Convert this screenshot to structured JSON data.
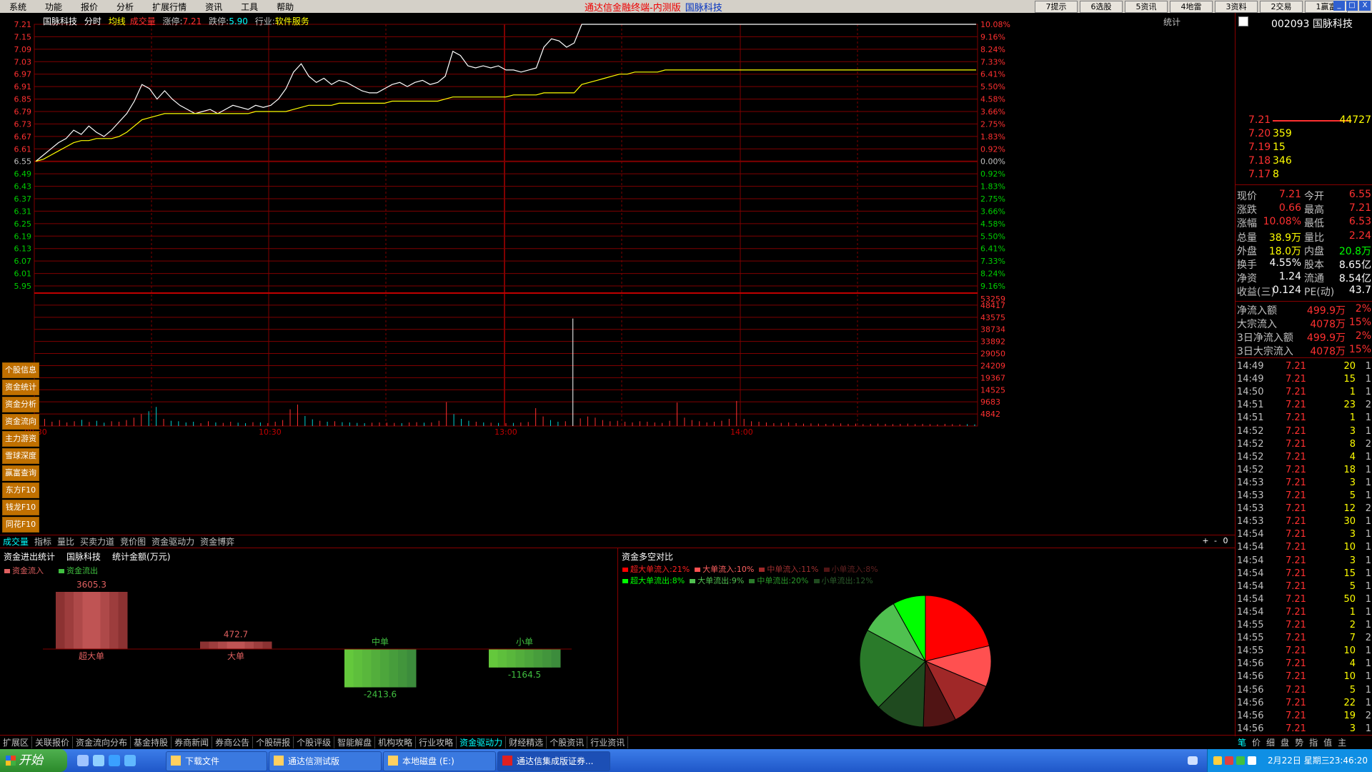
{
  "menu": [
    "系统",
    "功能",
    "报价",
    "分析",
    "扩展行情",
    "资讯",
    "工具",
    "帮助"
  ],
  "app_title": {
    "name": "通达信金融终端-内测版",
    "stock": "国脉科技"
  },
  "quick_buttons": [
    "7提示",
    "6选股",
    "5资讯",
    "4地雷",
    "3资料",
    "2交易",
    "1赢富"
  ],
  "window_controls": [
    "_",
    "□",
    "X"
  ],
  "chart_header": {
    "stock_name": "国脉科技",
    "mode": "分时",
    "avg_label": "均线",
    "vol_label": "成交量",
    "limit_up_label": "涨停:",
    "limit_up": "7.21",
    "limit_down_label": "跌停:",
    "limit_down": "5.90",
    "industry_label": "行业:",
    "industry": "软件服务"
  },
  "stat_button": "统计",
  "left_nav": [
    "个股信息",
    "资金统计",
    "资金分析",
    "资金流向",
    "主力游资",
    "雪球深度",
    "赢富查询",
    "东方F10",
    "钱龙F10",
    "同花F10"
  ],
  "chart_data": [
    {
      "type": "line",
      "title": "",
      "x_ticks": [
        "09:30",
        "10:30",
        "13:00",
        "14:00"
      ],
      "price_axis": {
        "labels": [
          "7.21",
          "7.15",
          "7.09",
          "7.03",
          "6.97",
          "6.91",
          "6.85",
          "6.79",
          "6.73",
          "6.67",
          "6.61",
          "6.55",
          "6.49",
          "6.43",
          "6.37",
          "6.31",
          "6.25",
          "6.19",
          "6.13",
          "6.07",
          "6.01",
          "5.95"
        ],
        "ylim": [
          5.95,
          7.21
        ]
      },
      "pct_axis": {
        "labels": [
          "10.08%",
          "9.16%",
          "8.24%",
          "7.33%",
          "6.41%",
          "5.50%",
          "4.58%",
          "3.66%",
          "2.75%",
          "1.83%",
          "0.92%",
          "0.00%",
          "0.92%",
          "1.83%",
          "2.75%",
          "3.66%",
          "4.58%",
          "5.50%",
          "6.41%",
          "7.33%",
          "8.24%",
          "9.16%"
        ]
      },
      "series": [
        {
          "color": "#ffffff",
          "values": [
            6.55,
            6.58,
            6.61,
            6.64,
            6.66,
            6.7,
            6.68,
            6.72,
            6.69,
            6.67,
            6.7,
            6.74,
            6.78,
            6.84,
            6.92,
            6.9,
            6.85,
            6.89,
            6.85,
            6.82,
            6.8,
            6.78,
            6.79,
            6.8,
            6.78,
            6.8,
            6.82,
            6.81,
            6.8,
            6.82,
            6.81,
            6.82,
            6.85,
            6.9,
            6.98,
            7.02,
            6.96,
            6.93,
            6.95,
            6.92,
            6.94,
            6.93,
            6.91,
            6.89,
            6.88,
            6.88,
            6.9,
            6.92,
            6.93,
            6.91,
            6.93,
            6.94,
            6.92,
            6.93,
            6.96,
            7.08,
            7.06,
            7.01,
            7.0,
            7.01,
            7.0,
            7.01,
            6.99,
            6.99,
            6.98,
            6.99,
            7.0,
            7.1,
            7.14,
            7.13,
            7.1,
            7.12,
            7.21,
            7.21,
            7.21,
            7.21,
            7.21,
            7.21,
            7.21,
            7.21,
            7.21,
            7.21,
            7.21,
            7.21,
            7.21,
            7.21,
            7.21,
            7.21,
            7.21,
            7.21,
            7.21,
            7.21,
            7.21,
            7.21,
            7.21,
            7.21,
            7.21,
            7.21,
            7.21,
            7.21,
            7.21,
            7.21,
            7.21,
            7.21,
            7.21,
            7.21,
            7.21,
            7.21,
            7.21,
            7.21,
            7.21,
            7.21,
            7.21,
            7.21,
            7.21,
            7.21,
            7.21,
            7.21,
            7.21,
            7.21,
            7.21,
            7.21,
            7.21,
            7.21,
            7.21
          ]
        },
        {
          "color": "#ffff00",
          "values": [
            6.55,
            6.56,
            6.58,
            6.6,
            6.62,
            6.64,
            6.65,
            6.65,
            6.66,
            6.66,
            6.66,
            6.67,
            6.69,
            6.72,
            6.75,
            6.76,
            6.77,
            6.78,
            6.78,
            6.78,
            6.78,
            6.78,
            6.78,
            6.78,
            6.78,
            6.78,
            6.78,
            6.78,
            6.78,
            6.79,
            6.79,
            6.79,
            6.79,
            6.79,
            6.8,
            6.81,
            6.82,
            6.82,
            6.82,
            6.82,
            6.83,
            6.83,
            6.83,
            6.83,
            6.83,
            6.83,
            6.83,
            6.84,
            6.84,
            6.84,
            6.84,
            6.84,
            6.84,
            6.84,
            6.85,
            6.86,
            6.86,
            6.86,
            6.86,
            6.86,
            6.86,
            6.86,
            6.86,
            6.87,
            6.87,
            6.87,
            6.87,
            6.88,
            6.88,
            6.88,
            6.88,
            6.88,
            6.92,
            6.93,
            6.94,
            6.95,
            6.96,
            6.97,
            6.97,
            6.98,
            6.98,
            6.98,
            6.98,
            6.99,
            6.99,
            6.99,
            6.99,
            6.99,
            6.99,
            6.99,
            6.99,
            6.99,
            6.99,
            6.99,
            6.99,
            6.99,
            6.99,
            6.99,
            6.99,
            6.99,
            6.99,
            6.99,
            6.99,
            6.99,
            6.99,
            6.99,
            6.99,
            6.99,
            6.99,
            6.99,
            6.99,
            6.99,
            6.99,
            6.99,
            6.99,
            6.99,
            6.99,
            6.99,
            6.99,
            6.99,
            6.99,
            6.99,
            6.99,
            6.99,
            6.99
          ]
        }
      ]
    },
    {
      "type": "bar",
      "title": "",
      "axis_labels": [
        "53259",
        "48417",
        "43575",
        "38734",
        "33892",
        "29050",
        "24209",
        "19367",
        "14525",
        "9683",
        "4842"
      ],
      "ylim": [
        0,
        53259
      ],
      "values": [
        2200,
        3000,
        1800,
        2500,
        1500,
        2000,
        2600,
        1700,
        2200,
        1400,
        2000,
        1800,
        2500,
        3500,
        5000,
        6200,
        8000,
        3000,
        2200,
        2000,
        1500,
        1800,
        1200,
        2000,
        1500,
        1300,
        1800,
        1400,
        1200,
        1600,
        1500,
        1200,
        1800,
        2500,
        7000,
        9000,
        4200,
        2800,
        2200,
        1800,
        2000,
        1600,
        1500,
        1300,
        1200,
        1400,
        1500,
        1400,
        1300,
        1200,
        1500,
        1600,
        1400,
        1500,
        2200,
        10000,
        5000,
        3000,
        2200,
        1800,
        1500,
        1400,
        1300,
        1200,
        1300,
        1500,
        1700,
        7500,
        4000,
        2500,
        1800,
        2000,
        45000,
        3200,
        4000,
        3500,
        2500,
        2000,
        2200,
        1800,
        1500,
        2000,
        1800,
        1500,
        1300,
        2200,
        9800,
        3500,
        2500,
        2000,
        1500,
        1800,
        2200,
        3000,
        10500,
        3000,
        2000,
        1800,
        1500,
        1200,
        1300,
        1500,
        1200,
        1000,
        1100,
        1000,
        900,
        1000,
        1100,
        900,
        1000,
        800,
        900,
        1000,
        900,
        800,
        900,
        1000,
        800,
        900,
        800,
        700,
        900,
        800,
        700,
        800,
        700
      ]
    },
    {
      "type": "bar",
      "title": "资金进出统计",
      "series": [
        {
          "name": "资金流入",
          "color": "#e06060"
        },
        {
          "name": "资金流出",
          "color": "#40c040"
        }
      ],
      "categories": [
        "超大单",
        "大单",
        "中单",
        "小单"
      ],
      "values": [
        3605.3,
        472.7,
        -2413.6,
        -1164.5
      ]
    },
    {
      "type": "pie",
      "title": "资金多空对比",
      "slices": [
        {
          "label": "超大单流入",
          "value": 21,
          "color": "#ff0000"
        },
        {
          "label": "大单流入",
          "value": 10,
          "color": "#ff5050"
        },
        {
          "label": "中单流入",
          "value": 11,
          "color": "#a02828"
        },
        {
          "label": "小单流入",
          "value": 8,
          "color": "#501414"
        },
        {
          "label": "小单流出",
          "value": 12,
          "color": "#1f4a1f"
        },
        {
          "label": "中单流出",
          "value": 20,
          "color": "#2a7a2a"
        },
        {
          "label": "大单流出",
          "value": 9,
          "color": "#50c050"
        },
        {
          "label": "超大单流出",
          "value": 8,
          "color": "#00ff00"
        }
      ]
    }
  ],
  "flow_panel": {
    "title": "资金进出统计",
    "stock": "国脉科技",
    "unit": "统计金额(万元)",
    "legend_in": "资金流入",
    "legend_out": "资金流出",
    "bars": [
      {
        "name": "超大单",
        "value": "3605.3"
      },
      {
        "name": "大单",
        "value": "472.7"
      },
      {
        "name": "中单",
        "value": "-2413.6"
      },
      {
        "name": "小单",
        "value": "-1164.5"
      }
    ]
  },
  "pie_panel": {
    "title": "资金多空对比",
    "legend_in": [
      {
        "label": "超大单流入:",
        "pct": "21%"
      },
      {
        "label": "大单流入:",
        "pct": "10%"
      },
      {
        "label": "中单流入:",
        "pct": "11%"
      },
      {
        "label": "小单流入:",
        "pct": "8%"
      }
    ],
    "legend_out": [
      {
        "label": "超大单流出:",
        "pct": "8%"
      },
      {
        "label": "大单流出:",
        "pct": "9%"
      },
      {
        "label": "中单流出:",
        "pct": "20%"
      },
      {
        "label": "小单流出:",
        "pct": "12%"
      }
    ]
  },
  "indicator_tabs": [
    "成交量",
    "指标",
    "量比",
    "买卖力道",
    "竞价图",
    "资金驱动力",
    "资金博弈"
  ],
  "indicator_ctrls": [
    "+",
    "-",
    "0"
  ],
  "quote": {
    "code": "002093",
    "name": "国脉科技",
    "order_book": [
      {
        "price": "7.21",
        "vol": "44727"
      },
      {
        "price": "7.20",
        "vol": "359"
      },
      {
        "price": "7.19",
        "vol": "15"
      },
      {
        "price": "7.18",
        "vol": "346"
      },
      {
        "price": "7.17",
        "vol": "8"
      }
    ],
    "stats": [
      {
        "l1": "现价",
        "v1": "7.21",
        "l2": "今开",
        "v2": "6.55"
      },
      {
        "l1": "涨跌",
        "v1": "0.66",
        "l2": "最高",
        "v2": "7.21"
      },
      {
        "l1": "涨幅",
        "v1": "10.08%",
        "l2": "最低",
        "v2": "6.53"
      },
      {
        "l1": "总量",
        "v1": "38.9万",
        "l2": "量比",
        "v2": "2.24"
      },
      {
        "l1": "外盘",
        "v1": "18.0万",
        "l2": "内盘",
        "v2": "20.8万"
      },
      {
        "l1": "换手",
        "v1": "4.55%",
        "l2": "股本",
        "v2": "8.65亿"
      },
      {
        "l1": "净资",
        "v1": "1.24",
        "l2": "流通",
        "v2": "8.54亿"
      },
      {
        "l1": "收益(三)",
        "v1": "0.124",
        "l2": "PE(动)",
        "v2": "43.7"
      }
    ],
    "flows": [
      {
        "label": "净流入额",
        "val": "499.9万",
        "pct": "2%"
      },
      {
        "label": "大宗流入",
        "val": "4078万",
        "pct": "15%"
      },
      {
        "label": "3日净流入额",
        "val": "499.9万",
        "pct": "2%"
      },
      {
        "label": "3日大宗流入",
        "val": "4078万",
        "pct": "15%"
      }
    ],
    "ticks": [
      {
        "time": "14:49",
        "price": "7.21",
        "vol": "20",
        "n": "1"
      },
      {
        "time": "14:49",
        "price": "7.21",
        "vol": "15",
        "n": "1"
      },
      {
        "time": "14:50",
        "price": "7.21",
        "vol": "1",
        "n": "1"
      },
      {
        "time": "14:51",
        "price": "7.21",
        "vol": "23",
        "n": "2"
      },
      {
        "time": "14:51",
        "price": "7.21",
        "vol": "1",
        "n": "1"
      },
      {
        "time": "14:52",
        "price": "7.21",
        "vol": "3",
        "n": "1"
      },
      {
        "time": "14:52",
        "price": "7.21",
        "vol": "8",
        "n": "2"
      },
      {
        "time": "14:52",
        "price": "7.21",
        "vol": "4",
        "n": "1"
      },
      {
        "time": "14:52",
        "price": "7.21",
        "vol": "18",
        "n": "1"
      },
      {
        "time": "14:53",
        "price": "7.21",
        "vol": "3",
        "n": "1"
      },
      {
        "time": "14:53",
        "price": "7.21",
        "vol": "5",
        "n": "1"
      },
      {
        "time": "14:53",
        "price": "7.21",
        "vol": "12",
        "n": "2"
      },
      {
        "time": "14:53",
        "price": "7.21",
        "vol": "30",
        "n": "1"
      },
      {
        "time": "14:54",
        "price": "7.21",
        "vol": "3",
        "n": "1"
      },
      {
        "time": "14:54",
        "price": "7.21",
        "vol": "10",
        "n": "1"
      },
      {
        "time": "14:54",
        "price": "7.21",
        "vol": "3",
        "n": "1"
      },
      {
        "time": "14:54",
        "price": "7.21",
        "vol": "15",
        "n": "1"
      },
      {
        "time": "14:54",
        "price": "7.21",
        "vol": "5",
        "n": "1"
      },
      {
        "time": "14:54",
        "price": "7.21",
        "vol": "50",
        "n": "1"
      },
      {
        "time": "14:54",
        "price": "7.21",
        "vol": "1",
        "n": "1"
      },
      {
        "time": "14:55",
        "price": "7.21",
        "vol": "2",
        "n": "1"
      },
      {
        "time": "14:55",
        "price": "7.21",
        "vol": "7",
        "n": "2"
      },
      {
        "time": "14:55",
        "price": "7.21",
        "vol": "10",
        "n": "1"
      },
      {
        "time": "14:56",
        "price": "7.21",
        "vol": "4",
        "n": "1"
      },
      {
        "time": "14:56",
        "price": "7.21",
        "vol": "10",
        "n": "1"
      },
      {
        "time": "14:56",
        "price": "7.21",
        "vol": "5",
        "n": "1"
      },
      {
        "time": "14:56",
        "price": "7.21",
        "vol": "22",
        "n": "1"
      },
      {
        "time": "14:56",
        "price": "7.21",
        "vol": "19",
        "n": "2"
      },
      {
        "time": "14:56",
        "price": "7.21",
        "vol": "3",
        "n": "1"
      }
    ]
  },
  "bottom_tabs": [
    "扩展区",
    "关联报价",
    "资金流向分布",
    "基金持股",
    "券商新闻",
    "券商公告",
    "个股研报",
    "个股评级",
    "智能解盘",
    "机构攻略",
    "行业攻略",
    "资金驱动力",
    "财经精选",
    "个股资讯",
    "行业资讯"
  ],
  "bottom_active": "资金驱动力",
  "right_tabs": [
    "笔",
    "价",
    "细",
    "盘",
    "势",
    "指",
    "值",
    "主"
  ],
  "taskbar": {
    "start": "开始",
    "tasks": [
      "下载文件",
      "通达信测试版",
      "本地磁盘 (E:)",
      "通达信集成版证券..."
    ],
    "date": "2月22日 星期三",
    "time": "23:46:20"
  },
  "colors": {
    "up": "#ff3030",
    "down": "#00ff00",
    "grid": "#800000",
    "bg": "#000000"
  }
}
